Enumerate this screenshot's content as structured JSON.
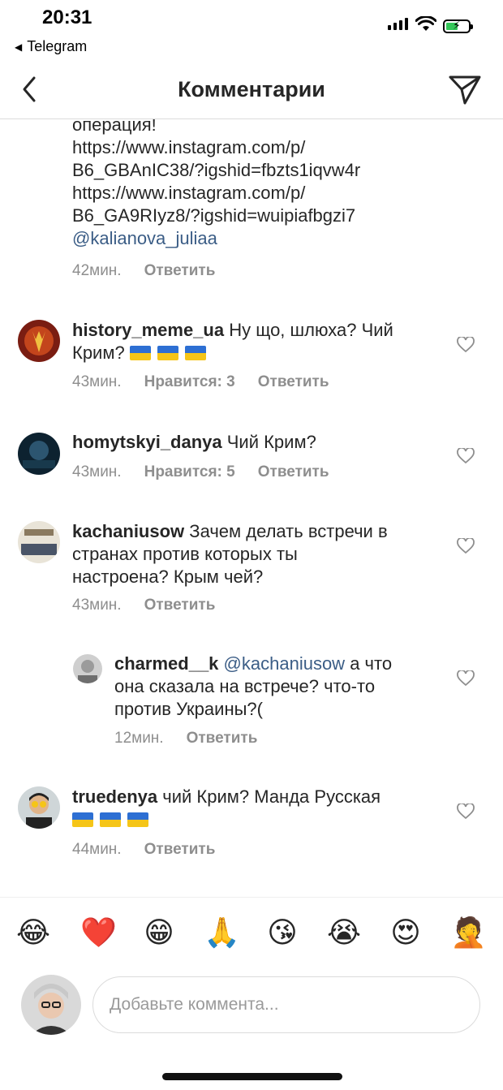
{
  "status_bar": {
    "time": "20:31",
    "back_app": "Telegram"
  },
  "nav": {
    "title": "Комментарии"
  },
  "comments": [
    {
      "lines": [
        "операция!",
        "https://www.instagram.com/p/",
        "B6_GBAnIC38/?igshid=fbzts1iqvw4r",
        "https://www.instagram.com/p/",
        "B6_GA9RIyz8/?igshid=wuipiafbgzi7"
      ],
      "mention": "@kalianova_juliaa",
      "time": "42мин.",
      "reply": "Ответить"
    },
    {
      "username": "history_meme_ua",
      "text": "Ну що, шлюха? Чий",
      "text2": "Крим?",
      "time": "43мин.",
      "likes": "Нравится: 3",
      "reply": "Ответить"
    },
    {
      "username": "homytskyi_danya",
      "text": "Чий Крим?",
      "time": "43мин.",
      "likes": "Нравится: 5",
      "reply": "Ответить"
    },
    {
      "username": "kachaniusow",
      "text": "Зачем делать встречи в",
      "text2": "странах против которых ты",
      "text3": "настроена? Крым чей?",
      "time": "43мин.",
      "reply": "Ответить"
    },
    {
      "username": "charmed__k",
      "mention": "@kachaniusow",
      "text": "а что",
      "text2": "она сказала на встрече? что-то",
      "text3": "против Украины?(",
      "time": "12мин.",
      "reply": "Ответить"
    },
    {
      "username": "truedenya",
      "text": "чий Крим? Манда Русская",
      "time": "44мин.",
      "reply": "Ответить"
    }
  ],
  "emoji_bar": [
    "😂",
    "❤️",
    "😁",
    "🙏",
    "😘",
    "😭",
    "😍",
    "🤦"
  ],
  "composer": {
    "placeholder": "Добавьте коммента..."
  },
  "colors": {
    "mention": "#3b5d86",
    "meta": "#8e8e8e",
    "flag_blue": "#2d6fd3",
    "flag_yellow": "#f5c518"
  }
}
